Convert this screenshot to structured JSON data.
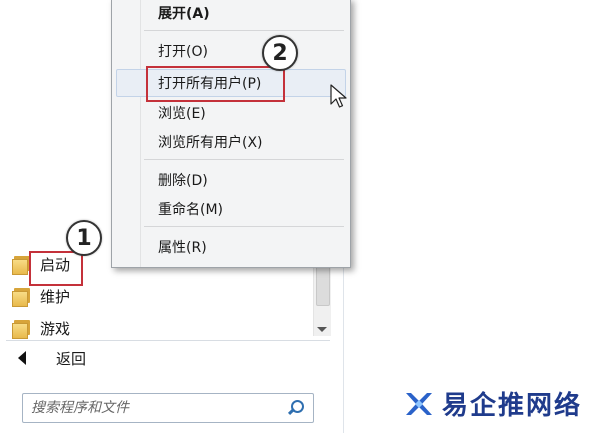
{
  "context_menu": {
    "items": [
      {
        "label": "展开(A)",
        "bold": true
      },
      {
        "label": "打开(O)"
      },
      {
        "label": "打开所有用户(P)"
      },
      {
        "label": "浏览(E)"
      },
      {
        "label": "浏览所有用户(X)"
      },
      {
        "label": "删除(D)"
      },
      {
        "label": "重命名(M)"
      },
      {
        "label": "属性(R)"
      }
    ]
  },
  "programs": {
    "items": [
      {
        "label": "启动",
        "icon": "folder-icon"
      },
      {
        "label": "维护",
        "icon": "folder-icon"
      },
      {
        "label": "游戏",
        "icon": "folder-icon"
      }
    ]
  },
  "back": {
    "label": "返回"
  },
  "search": {
    "placeholder": "搜索程序和文件"
  },
  "annotations": {
    "step1": "1",
    "step2": "2",
    "highlight_color": "#c4313a"
  },
  "watermark": {
    "text": "易企推网络"
  },
  "colors": {
    "menu_bg": "#f3f4f5",
    "hover_bg": "#e9eef5",
    "folder": "#e8b94c"
  }
}
